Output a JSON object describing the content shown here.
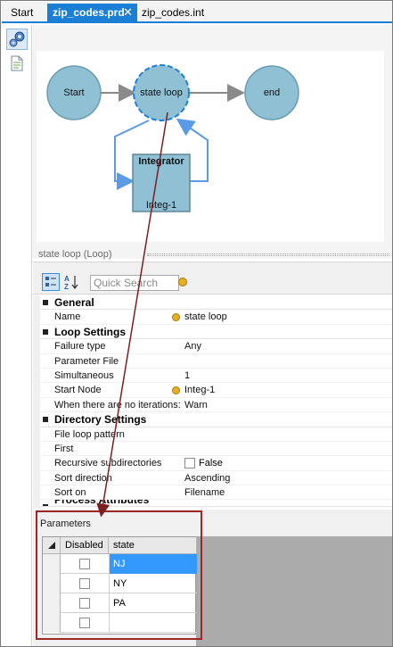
{
  "tabs": [
    {
      "label": "Start"
    },
    {
      "label": "zip_codes.prd",
      "close": "✕"
    },
    {
      "label": "zip_codes.int"
    }
  ],
  "diagram": {
    "nodes": {
      "start": "Start",
      "state_loop": "state loop",
      "end": "end"
    },
    "integrator": {
      "title": "Integrator",
      "instance": "Integ-1"
    }
  },
  "property_panel": {
    "header": "state loop (Loop)",
    "search_placeholder": "Quick Search",
    "categories": [
      {
        "title": "General",
        "rows": [
          {
            "key": "Name",
            "value": "state loop",
            "icon": "info-icon"
          }
        ]
      },
      {
        "title": "Loop Settings",
        "rows": [
          {
            "key": "Failure type",
            "value": "Any"
          },
          {
            "key": "Parameter File",
            "value": ""
          },
          {
            "key": "Simultaneous",
            "value": "1"
          },
          {
            "key": "Start Node",
            "value": "Integ-1",
            "icon": "info-icon"
          },
          {
            "key": "When there are no iterations:",
            "value": "Warn"
          }
        ]
      },
      {
        "title": "Directory Settings",
        "rows": [
          {
            "key": "File loop pattern",
            "value": ""
          },
          {
            "key": "First",
            "value": ""
          },
          {
            "key": "Recursive subdirectories",
            "value": "False",
            "checkbox": true
          },
          {
            "key": "Sort direction",
            "value": "Ascending"
          },
          {
            "key": "Sort on",
            "value": "Filename"
          }
        ]
      },
      {
        "title": "Process Attributes",
        "rows": []
      }
    ]
  },
  "parameters": {
    "title": "Parameters",
    "columns": [
      "Disabled",
      "state"
    ],
    "rows": [
      {
        "disabled": false,
        "state": "NJ",
        "selected": true
      },
      {
        "disabled": false,
        "state": "NY"
      },
      {
        "disabled": false,
        "state": "PA"
      },
      {
        "disabled": false,
        "state": ""
      }
    ]
  },
  "colors": {
    "accent": "#1c7fd6",
    "node_fill": "#8fc0d3",
    "arrow_red": "#7d1f1f",
    "highlight_box": "#9b2727",
    "selection": "#3399ff"
  }
}
